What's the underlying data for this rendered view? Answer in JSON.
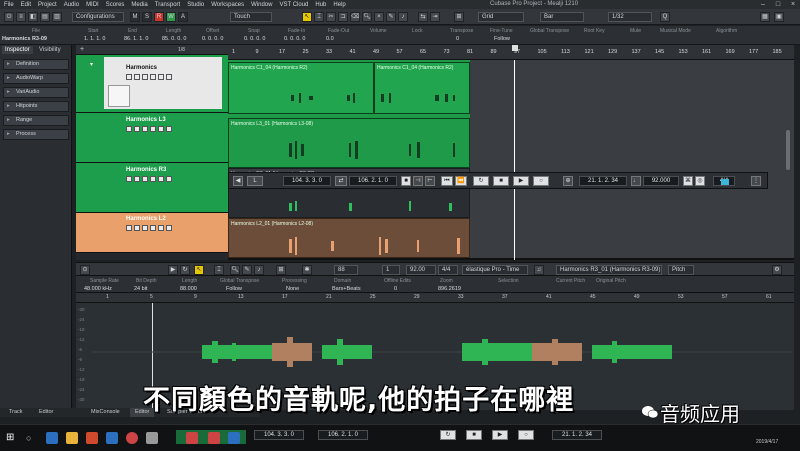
{
  "app": {
    "title": "Cubase Pro Project - Mealji 1210",
    "menu": [
      "File",
      "Edit",
      "Project",
      "Audio",
      "MIDI",
      "Scores",
      "Media",
      "Transport",
      "Studio",
      "Workspaces",
      "Window",
      "VST Cloud",
      "Hub",
      "Help"
    ]
  },
  "toolbar": {
    "configurations_label": "Configurations",
    "mode_buttons": [
      "M",
      "S",
      "R",
      "W",
      "A"
    ],
    "touch_label": "Touch",
    "grid_label": "Grid",
    "bar_label": "Bar",
    "quantize_label": "1/32"
  },
  "infoline": {
    "selected_track": "Harmonics R3-09",
    "headers": [
      "File",
      "Start",
      "End",
      "Length",
      "Offset",
      "Snap",
      "Fade-In",
      "Fade-Out",
      "Volume",
      "Lock",
      "Transpose",
      "Fine-Tune",
      "Global Transpose",
      "Root Key",
      "Mute",
      "Musical Mode",
      "Algorithm"
    ],
    "values": [
      "Harmonics R3-09",
      "1. 1. 1. 0",
      "86. 1. 1. 0",
      "85. 0. 0. 0",
      "0. 0. 0. 0",
      "0. 0. 0. 0",
      "0. 0. 0. 0",
      "0.0",
      "",
      "0",
      "0",
      "Follow",
      "",
      "",
      "",
      "élastique Pro - Time"
    ]
  },
  "inspector": {
    "tabs": [
      "Inspector",
      "Visibility"
    ],
    "sections": [
      "Definition",
      "AudioWarp",
      "VariAudio",
      "Hitpoints",
      "Range",
      "Process"
    ]
  },
  "tracklist": {
    "header_count": "1/8",
    "tracks": [
      {
        "name": "Harmonics",
        "color": "#e8e8e8"
      },
      {
        "name": "Harmonics L3",
        "color": "#1d9e4c"
      },
      {
        "name": "Harmonics R3",
        "color": "#1d9e4c"
      },
      {
        "name": "Harmonics L2",
        "color": "#e9a06a"
      }
    ]
  },
  "ruler": {
    "ticks": [
      "1",
      "9",
      "17",
      "25",
      "33",
      "41",
      "49",
      "57",
      "65",
      "73",
      "81",
      "89",
      "97",
      "105",
      "113",
      "121",
      "129",
      "137",
      "145",
      "153",
      "161",
      "169",
      "177",
      "185"
    ]
  },
  "events": [
    {
      "name": "Harmonics C1_04 (Harmonics R2)"
    },
    {
      "name": "Harmonics C1_04 (Harmonics R2)"
    },
    {
      "name": "Harmonics L3_01 (Harmonics L3-08)"
    },
    {
      "name": "Harmonics R3_01 (Harmonics R3-09)"
    },
    {
      "name": "Harmonics L2_01 (Harmonics L2-08)"
    }
  ],
  "transport": {
    "left_locator": "104. 3. 3. 0",
    "right_locator": "106. 2. 1. 0",
    "position": "21. 1. 2. 34",
    "tempo": "92.000",
    "signature": "4/4"
  },
  "lower_zone": {
    "toolbar": {
      "zoom": "88",
      "value2": "1",
      "tempo": "92.00",
      "signature": "4/4",
      "algorithm": "élastique Pro - Time",
      "clip_name": "Harmonics R3_01 (Harmonics R3-09)",
      "pitch_label": "Pitch"
    },
    "info_headers": [
      "Sample Rate",
      "Bit Depth",
      "Length",
      "Global Transpose",
      "Processing",
      "Domain",
      "Offline Edits",
      "Zoom",
      "Selection",
      "Current Pitch",
      "Original Pitch"
    ],
    "info_values": [
      "48.000 kHz",
      "24 bit",
      "88.000",
      "Follow",
      "None",
      "Bars+Beats",
      "0",
      "896.2619",
      "",
      "",
      ""
    ],
    "ruler_ticks": [
      "1",
      "5",
      "9",
      "13",
      "17",
      "21",
      "25",
      "29",
      "33",
      "37",
      "41",
      "45",
      "49",
      "53",
      "57",
      "61"
    ],
    "db_labels": [
      "-30",
      "-24",
      "-18",
      "-12",
      "-6",
      "-9",
      "-12",
      "-18",
      "-24",
      "-30"
    ]
  },
  "bottom_tabs": [
    "Track",
    "Editor",
    "MixConsole",
    "Editor",
    "Sampler Control"
  ],
  "taskbar": {
    "transport_left": "104. 3. 3. 0",
    "transport_right": "106. 2. 1. 0",
    "position": "21. 1. 2. 34",
    "date": "2019/4/17"
  },
  "subtitle": "不同顏色的音軌呢,他的拍子在哪裡",
  "watermark": "音频应用",
  "colors": {
    "green_event": "#1f9a48",
    "orange_event": "#a5704a",
    "accent_yellow": "#e6c800"
  }
}
